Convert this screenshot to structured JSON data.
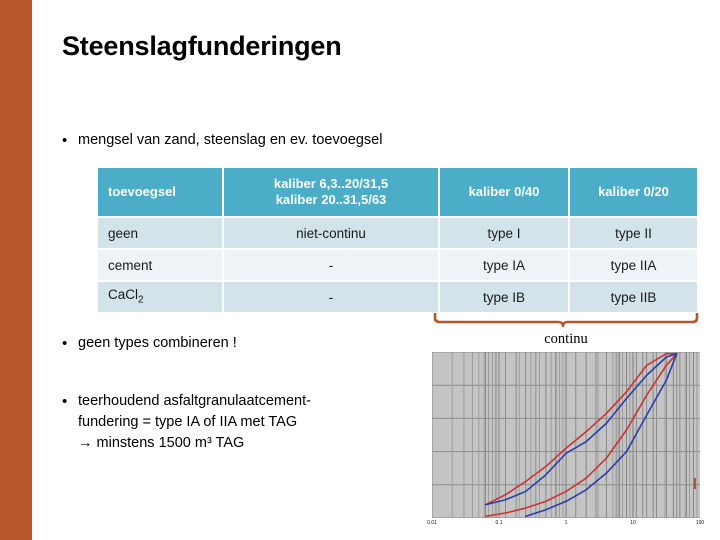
{
  "slide": {
    "title": "Steenslagfunderingen",
    "accent_color": "#b7562a",
    "table_header_color": "#4badc7",
    "row_color_a": "#d3e3ea",
    "row_color_b": "#edf3f6"
  },
  "bullets": {
    "marker": "•",
    "b1": "mengsel van zand, steenslag en ev. toevoegsel",
    "b2": "geen types combineren !",
    "b3_line1": "teerhoudend asfaltgranulaatcement-",
    "b3_line2": "fundering = type IA of IIA met TAG",
    "b3_line3": "→ minstens 1500 m³ TAG"
  },
  "table": {
    "headers": [
      "toevoegsel",
      "kaliber 6,3..20/31,5",
      "kaliber 0/40",
      "kaliber 0/20"
    ],
    "header_col2_line1": "kaliber 6,3..20/31,5",
    "header_col2_line2": "kaliber 20..31,5/63",
    "rows": [
      {
        "toevoegsel": "geen",
        "kaliber_grof": "niet-continu",
        "kaliber_0_40": "type I",
        "kaliber_0_20": "type II"
      },
      {
        "toevoegsel": "cement",
        "kaliber_grof": "-",
        "kaliber_0_40": "type IA",
        "kaliber_0_20": "type IIA"
      },
      {
        "toevoegsel": "CaCl",
        "toevoegsel_sub": "2",
        "kaliber_grof": "-",
        "kaliber_0_40": "type IB",
        "kaliber_0_20": "type IIB"
      }
    ]
  },
  "brace": {
    "label": "continu"
  },
  "chart_data": {
    "type": "line",
    "title": "",
    "xlabel": "",
    "ylabel": "",
    "xscale": "log",
    "xlim": [
      0.01,
      100
    ],
    "ylim": [
      0,
      100
    ],
    "xticks": [
      0.01,
      0.1,
      1,
      10,
      100
    ],
    "xtick_labels": [
      "0.01",
      "0.1",
      "1",
      "10",
      "100"
    ],
    "grid": true,
    "plot_bg": "#c4c4c4",
    "legend": "none",
    "series": [
      {
        "name": "red-upper",
        "color": "#cc3333",
        "x": [
          0.063,
          0.125,
          0.25,
          0.5,
          1,
          2,
          4,
          8,
          16,
          31.5,
          45
        ],
        "y": [
          8,
          14,
          22,
          31,
          42,
          52,
          63,
          76,
          92,
          99,
          99
        ]
      },
      {
        "name": "red-lower",
        "color": "#cc3333",
        "x": [
          0.063,
          0.125,
          0.25,
          0.5,
          1,
          2,
          4,
          8,
          16,
          31.5,
          45
        ],
        "y": [
          1,
          3,
          6,
          10,
          16,
          24,
          36,
          53,
          74,
          92,
          99
        ]
      },
      {
        "name": "blue-upper",
        "color": "#2b3ea8",
        "x": [
          0.063,
          0.125,
          0.25,
          0.5,
          1,
          2,
          4,
          8,
          16,
          31.5,
          45
        ],
        "y": [
          8,
          11,
          16,
          26,
          39,
          46,
          57,
          72,
          86,
          97,
          99
        ]
      },
      {
        "name": "blue-lower",
        "color": "#2b3ea8",
        "x": [
          0.25,
          0.5,
          1,
          2,
          4,
          8,
          16,
          31.5,
          45
        ],
        "y": [
          1,
          5,
          10,
          17,
          27,
          40,
          62,
          83,
          99
        ]
      }
    ]
  }
}
